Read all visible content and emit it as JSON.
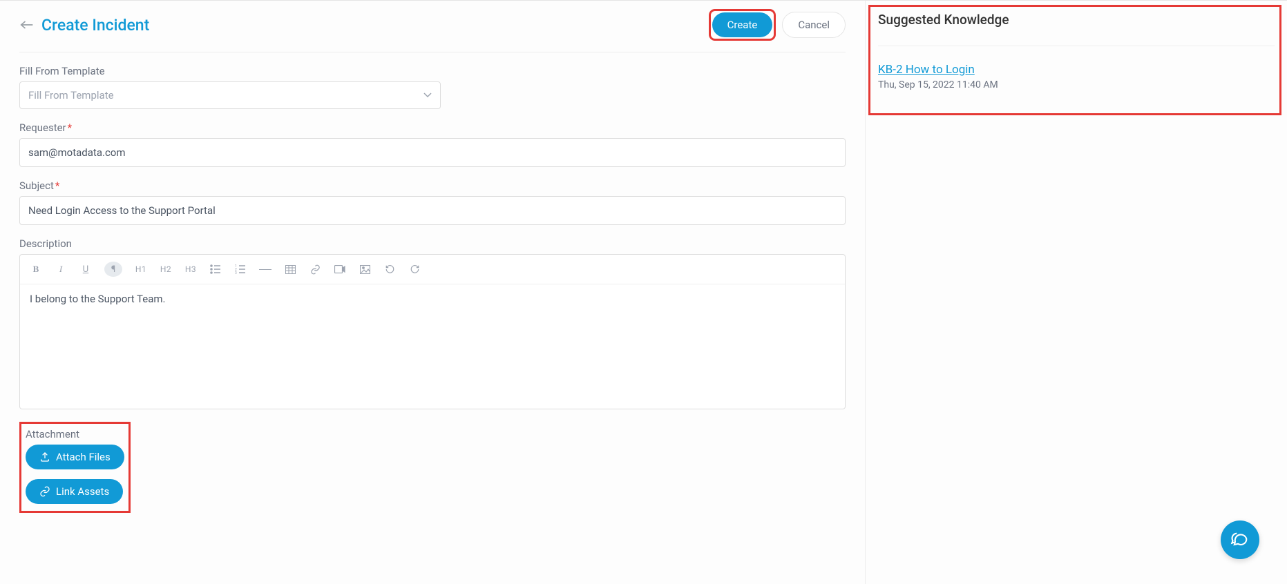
{
  "header": {
    "title": "Create Incident",
    "create_label": "Create",
    "cancel_label": "Cancel"
  },
  "form": {
    "template_label": "Fill From Template",
    "template_placeholder": "Fill From Template",
    "requester_label": "Requester",
    "requester_value": "sam@motadata.com",
    "subject_label": "Subject",
    "subject_value": "Need Login Access to the Support Portal",
    "description_label": "Description",
    "description_value": "I belong to the Support Team.",
    "attachment_label": "Attachment",
    "attach_files_label": "Attach Files",
    "link_assets_label": "Link Assets"
  },
  "toolbar": {
    "h1": "H1",
    "h2": "H2",
    "h3": "H3"
  },
  "sidebar": {
    "title": "Suggested Knowledge",
    "items": [
      {
        "title": "KB-2 How to Login",
        "date": "Thu, Sep 15, 2022 11:40 AM"
      }
    ]
  }
}
